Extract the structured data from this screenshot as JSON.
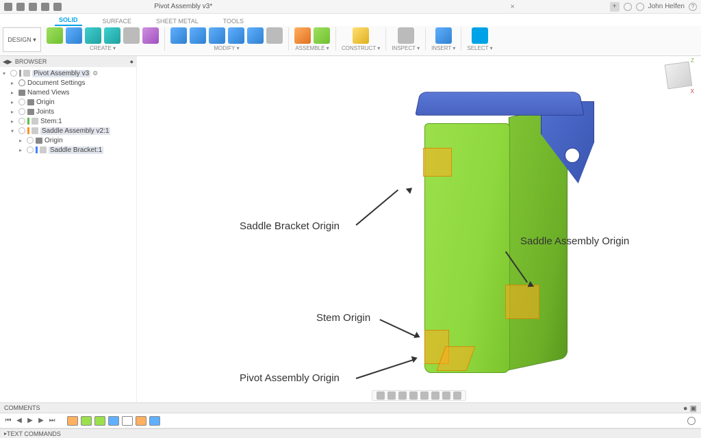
{
  "titlebar": {
    "doc_title": "Pivot Assembly v3*",
    "user_name": "John Helfen"
  },
  "ribbon_tabs": {
    "solid": "SOLID",
    "surface": "SURFACE",
    "sheet_metal": "SHEET METAL",
    "tools": "TOOLS"
  },
  "ribbon": {
    "design_label": "DESIGN ▾",
    "groups": {
      "create": "CREATE ▾",
      "modify": "MODIFY ▾",
      "assemble": "ASSEMBLE ▾",
      "construct": "CONSTRUCT ▾",
      "inspect": "INSPECT ▾",
      "insert": "INSERT ▾",
      "select": "SELECT ▾"
    }
  },
  "browser": {
    "header": "BROWSER",
    "root": "Pivot Assembly v3",
    "items": {
      "doc_settings": "Document Settings",
      "named_views": "Named Views",
      "origin": "Origin",
      "joints": "Joints",
      "stem": "Stem:1",
      "saddle_asm": "Saddle Assembly v2:1",
      "sub_origin": "Origin",
      "saddle_bracket": "Saddle Bracket:1"
    }
  },
  "annotations": {
    "saddle_bracket_origin": "Saddle Bracket Origin",
    "saddle_assembly_origin": "Saddle Assembly Origin",
    "stem_origin": "Stem Origin",
    "pivot_assembly_origin": "Pivot Assembly Origin"
  },
  "viewcube": {
    "z": "Z",
    "x": "X"
  },
  "bottom_bars": {
    "comments": "COMMENTS",
    "text_commands": "TEXT COMMANDS"
  }
}
